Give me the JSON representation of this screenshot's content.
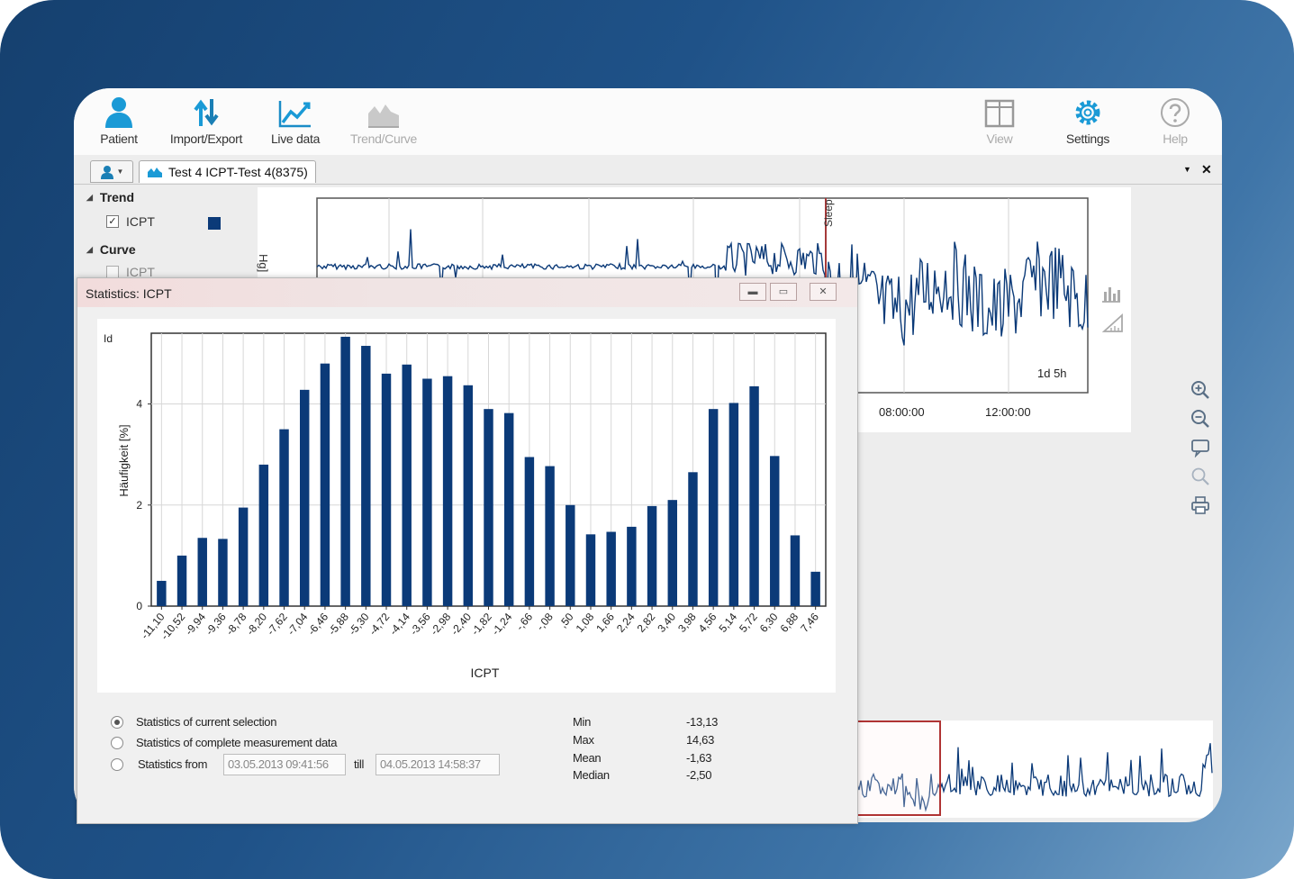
{
  "toolbar": {
    "patient": "Patient",
    "import_export": "Import/Export",
    "live_data": "Live data",
    "trend_curve": "Trend/Curve",
    "view": "View",
    "settings": "Settings",
    "help": "Help"
  },
  "tab": {
    "title": "Test 4 ICPT-Test 4(8375)"
  },
  "panel": {
    "trend_group": "Trend",
    "trend_item": "ICPT",
    "curve_group": "Curve",
    "curve_item": "ICPT",
    "trend_color": "#0b3a78"
  },
  "trend_chart": {
    "y_unit_partial": "Hg]",
    "marker_label": "Sleep",
    "duration": "1d 5h",
    "x_ticks": [
      "08:00:00",
      "12:00:00"
    ]
  },
  "dialog": {
    "title": "Statistics: ICPT",
    "radio_current": "Statistics of current selection",
    "radio_complete": "Statistics of complete measurement data",
    "radio_from": "Statistics from",
    "till": "till",
    "from_value": "03.05.2013 09:41:56",
    "till_value": "04.05.2013 14:58:37",
    "stats": [
      {
        "label": "Min",
        "value": "-13,13"
      },
      {
        "label": "Max",
        "value": "14,63"
      },
      {
        "label": "Mean",
        "value": "-1,63"
      },
      {
        "label": "Median",
        "value": "-2,50"
      }
    ]
  },
  "chart_data": {
    "type": "bar",
    "xlabel": "ICPT",
    "ylabel": "Häufigkeit [%]",
    "y_corner_label": "Id",
    "ylim": [
      0,
      5.4
    ],
    "yticks": [
      0,
      2,
      4
    ],
    "grid": true,
    "color": "#0b3a78",
    "categories": [
      "-11,10",
      "-10,52",
      "-9,94",
      "-9,36",
      "-8,78",
      "-8,20",
      "-7,62",
      "-7,04",
      "-6,46",
      "-5,88",
      "-5,30",
      "-4,72",
      "-4,14",
      "-3,56",
      "-2,98",
      "-2,40",
      "-1,82",
      "-1,24",
      "-,66",
      "-,08",
      ",50",
      "1,08",
      "1,66",
      "2,24",
      "2,82",
      "3,40",
      "3,98",
      "4,56",
      "5,14",
      "5,72",
      "6,30",
      "6,88",
      "7,46"
    ],
    "values": [
      0.5,
      1.0,
      1.35,
      1.33,
      1.95,
      2.8,
      3.5,
      4.28,
      4.8,
      5.33,
      5.15,
      4.6,
      4.78,
      4.5,
      4.55,
      4.37,
      3.9,
      3.82,
      2.95,
      2.77,
      2.0,
      1.42,
      1.47,
      1.57,
      1.98,
      2.1,
      2.65,
      3.9,
      4.02,
      4.35,
      2.97,
      1.4,
      0.68
    ]
  }
}
